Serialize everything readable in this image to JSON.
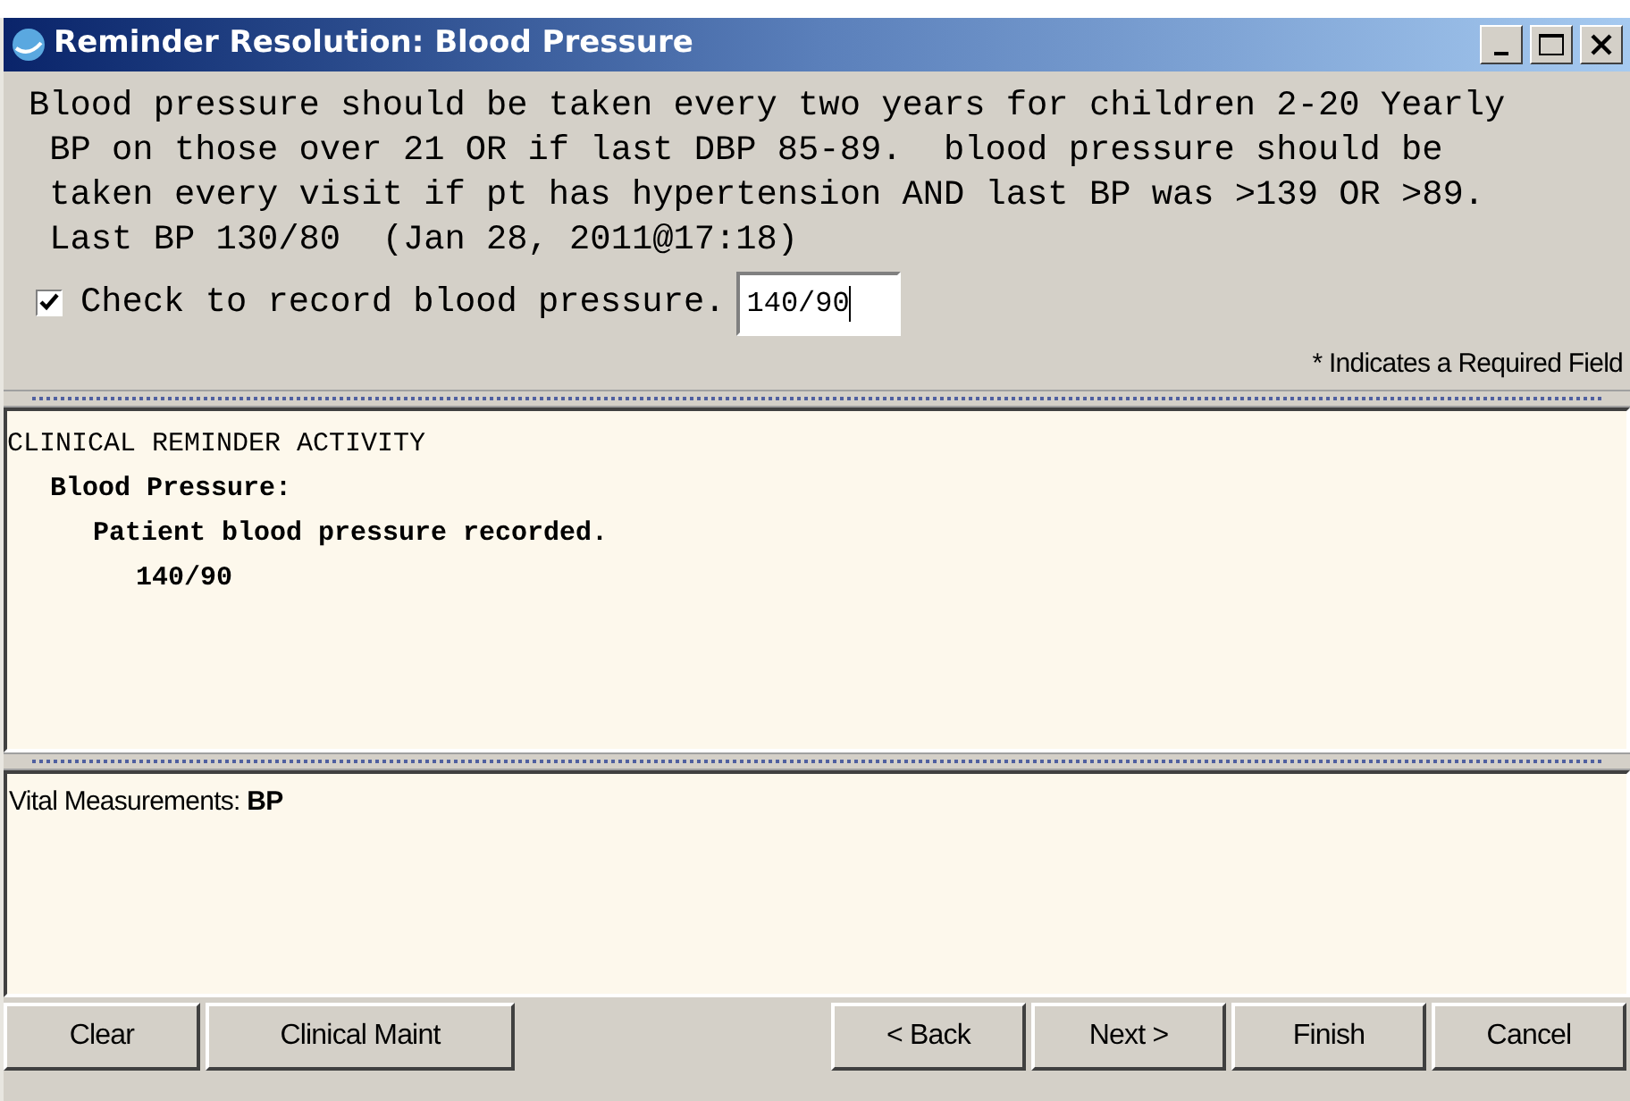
{
  "window": {
    "title": "Reminder Resolution: Blood Pressure"
  },
  "description": [
    "Blood pressure should be taken every two years for children 2-20 Yearly",
    " BP on those over 21 OR if last DBP 85-89.  blood pressure should be",
    " taken every visit if pt has hypertension AND last BP was >139 OR >89.",
    " Last BP 130/80  (Jan 28, 2011@17:18)"
  ],
  "record_checkbox": {
    "label": "Check to record blood pressure.",
    "checked": true,
    "value": "140/90"
  },
  "required_note": "* Indicates a Required Field",
  "activity": [
    {
      "text": "CLINICAL REMINDER ACTIVITY",
      "bold": false,
      "children": [
        {
          "text": "Blood Pressure:",
          "bold": true,
          "children": [
            {
              "text": "Patient blood pressure recorded.",
              "bold": true,
              "children": [
                {
                  "text": "140/90",
                  "bold": true
                }
              ]
            }
          ]
        }
      ]
    }
  ],
  "vitals": "Vital Measurements: **BP**",
  "buttons_left": [
    "Clear",
    "Clinical Maint"
  ],
  "buttons_right": [
    "< Back",
    "Next >",
    "Finish",
    "Cancel"
  ]
}
